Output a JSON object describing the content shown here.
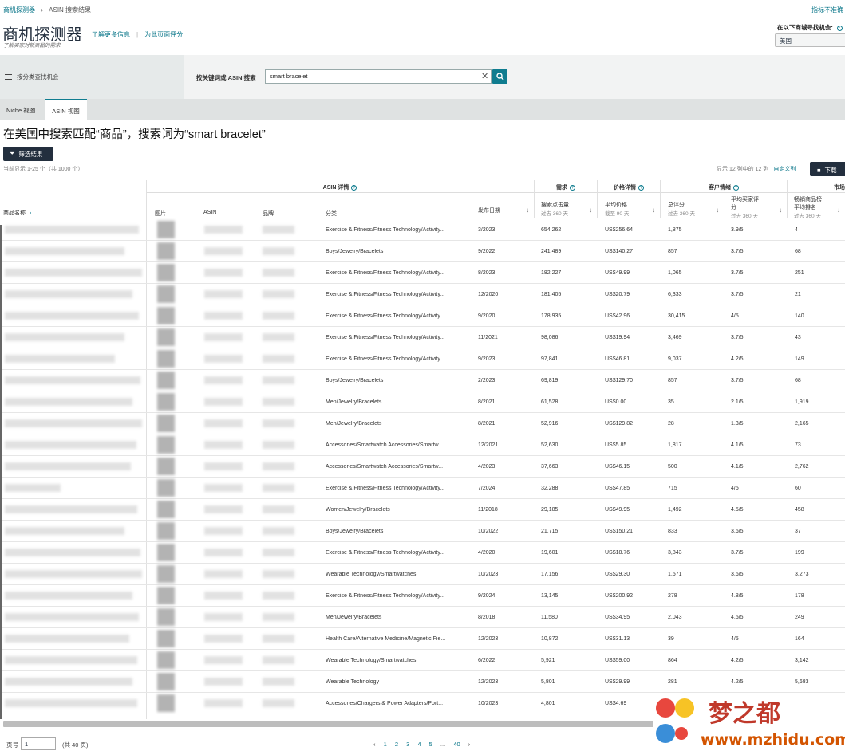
{
  "breadcrumb": {
    "root": "商机探测器",
    "sep": "›",
    "current": "ASIN 搜索结果"
  },
  "feedback_link": "指标不准确",
  "title": "商机探测器",
  "links": {
    "learn_more": "了解更多信息",
    "rate_page": "为此页面评分"
  },
  "subtitle": "了解买家对新商品的需求",
  "marketplace": {
    "label": "在以下商城寻找机会:",
    "value": "美国"
  },
  "category_search_label": "按分类查找机会",
  "keyword_label": "按关键词或 ASIN 搜索",
  "search_value": "smart bracelet",
  "tabs": {
    "niche": "Niche 视图",
    "asin": "ASIN 视图"
  },
  "results_heading": "在美国中搜索匹配“商品”，搜索词为“smart bracelet”",
  "filter_label": "筛选结果",
  "count_text": "当前显示 1-25 个（共 1000 个）",
  "columns_shown": "显示 12 列中的 12 列",
  "customize_columns": "自定义列",
  "download_label": "下载",
  "groups": {
    "asin_details": "ASIN 详情",
    "demand": "需求",
    "price_details": "价格详情",
    "customer_sentiment": "客户情绪",
    "market": "市场"
  },
  "columns": {
    "product_name": "商品名称",
    "image": "图片",
    "asin": "ASIN",
    "brand": "品牌",
    "category": "分类",
    "launch_date": "发布日期",
    "clicks": "搜索点击量",
    "clicks_sub": "过去 360 天",
    "avg_price": "平均价格",
    "avg_price_sub": "截至 90 天",
    "reviews": "总评分",
    "reviews_sub": "过去 360 天",
    "rating_l1": "平均买家评",
    "rating_l2": "分",
    "rating_sub": "过去 360 天",
    "bsr_l1": "畅销商品榜",
    "bsr_l2": "平均排名",
    "bsr_sub": "过去 360 天"
  },
  "rows": [
    {
      "category": "Exercise & Fitness/Fitness Technology/Activity...",
      "date": "3/2023",
      "clicks": "654,262",
      "price": "US$256.64",
      "reviews": "1,875",
      "rating": "3.9/5",
      "bsr": "4"
    },
    {
      "category": "Boys/Jewelry/Bracelets",
      "date": "9/2022",
      "clicks": "241,489",
      "price": "US$140.27",
      "reviews": "857",
      "rating": "3.7/5",
      "bsr": "68"
    },
    {
      "category": "Exercise & Fitness/Fitness Technology/Activity...",
      "date": "8/2023",
      "clicks": "182,227",
      "price": "US$49.99",
      "reviews": "1,065",
      "rating": "3.7/5",
      "bsr": "251"
    },
    {
      "category": "Exercise & Fitness/Fitness Technology/Activity...",
      "date": "12/2020",
      "clicks": "181,405",
      "price": "US$20.79",
      "reviews": "6,333",
      "rating": "3.7/5",
      "bsr": "21"
    },
    {
      "category": "Exercise & Fitness/Fitness Technology/Activity...",
      "date": "9/2020",
      "clicks": "178,935",
      "price": "US$42.96",
      "reviews": "30,415",
      "rating": "4/5",
      "bsr": "140"
    },
    {
      "category": "Exercise & Fitness/Fitness Technology/Activity...",
      "date": "11/2021",
      "clicks": "98,086",
      "price": "US$19.94",
      "reviews": "3,469",
      "rating": "3.7/5",
      "bsr": "43"
    },
    {
      "category": "Exercise & Fitness/Fitness Technology/Activity...",
      "date": "9/2023",
      "clicks": "97,841",
      "price": "US$46.81",
      "reviews": "9,037",
      "rating": "4.2/5",
      "bsr": "149"
    },
    {
      "category": "Boys/Jewelry/Bracelets",
      "date": "2/2023",
      "clicks": "69,819",
      "price": "US$129.70",
      "reviews": "857",
      "rating": "3.7/5",
      "bsr": "68"
    },
    {
      "category": "Men/Jewelry/Bracelets",
      "date": "8/2021",
      "clicks": "61,528",
      "price": "US$0.00",
      "reviews": "35",
      "rating": "2.1/5",
      "bsr": "1,919"
    },
    {
      "category": "Men/Jewelry/Bracelets",
      "date": "8/2021",
      "clicks": "52,916",
      "price": "US$129.82",
      "reviews": "28",
      "rating": "1.3/5",
      "bsr": "2,165"
    },
    {
      "category": "Accessories/Smartwatch Accessories/Smartw...",
      "date": "12/2021",
      "clicks": "52,630",
      "price": "US$5.85",
      "reviews": "1,817",
      "rating": "4.1/5",
      "bsr": "73"
    },
    {
      "category": "Accessories/Smartwatch Accessories/Smartw...",
      "date": "4/2023",
      "clicks": "37,663",
      "price": "US$46.15",
      "reviews": "500",
      "rating": "4.1/5",
      "bsr": "2,762"
    },
    {
      "category": "Exercise & Fitness/Fitness Technology/Activity...",
      "date": "7/2024",
      "clicks": "32,288",
      "price": "US$47.85",
      "reviews": "715",
      "rating": "4/5",
      "bsr": "60"
    },
    {
      "category": "Women/Jewelry/Bracelets",
      "date": "11/2018",
      "clicks": "29,185",
      "price": "US$49.95",
      "reviews": "1,492",
      "rating": "4.5/5",
      "bsr": "458"
    },
    {
      "category": "Boys/Jewelry/Bracelets",
      "date": "10/2022",
      "clicks": "21,715",
      "price": "US$150.21",
      "reviews": "833",
      "rating": "3.6/5",
      "bsr": "37"
    },
    {
      "category": "Exercise & Fitness/Fitness Technology/Activity...",
      "date": "4/2020",
      "clicks": "19,601",
      "price": "US$18.76",
      "reviews": "3,843",
      "rating": "3.7/5",
      "bsr": "199"
    },
    {
      "category": "Wearable Technology/Smartwatches",
      "date": "10/2023",
      "clicks": "17,156",
      "price": "US$29.30",
      "reviews": "1,571",
      "rating": "3.6/5",
      "bsr": "3,273"
    },
    {
      "category": "Exercise & Fitness/Fitness Technology/Activity...",
      "date": "9/2024",
      "clicks": "13,145",
      "price": "US$200.92",
      "reviews": "278",
      "rating": "4.8/5",
      "bsr": "178"
    },
    {
      "category": "Men/Jewelry/Bracelets",
      "date": "8/2018",
      "clicks": "11,580",
      "price": "US$34.95",
      "reviews": "2,043",
      "rating": "4.5/5",
      "bsr": "249"
    },
    {
      "category": "Health Care/Alternative Medicine/Magnetic Fie...",
      "date": "12/2023",
      "clicks": "10,872",
      "price": "US$31.13",
      "reviews": "39",
      "rating": "4/5",
      "bsr": "164"
    },
    {
      "category": "Wearable Technology/Smartwatches",
      "date": "6/2022",
      "clicks": "5,921",
      "price": "US$59.00",
      "reviews": "864",
      "rating": "4.2/5",
      "bsr": "3,142"
    },
    {
      "category": "Wearable Technology",
      "date": "12/2023",
      "clicks": "5,801",
      "price": "US$29.99",
      "reviews": "281",
      "rating": "4.2/5",
      "bsr": "5,683"
    },
    {
      "category": "Accessories/Chargers & Power Adapters/Port...",
      "date": "10/2023",
      "clicks": "4,801",
      "price": "US$4.69",
      "reviews": "",
      "rating": "",
      "bsr": ""
    }
  ],
  "footer": {
    "page_label": "页号",
    "page_value": "1",
    "page_total": "(共 40 页)"
  },
  "pagination": [
    "1",
    "2",
    "3",
    "4",
    "5",
    "...",
    "40"
  ],
  "watermark": {
    "text": "梦之都",
    "url": "www.mzhidu.com"
  },
  "colors": {
    "accent": "#0f7c8f",
    "dark": "#232f3e",
    "link": "#007185"
  }
}
